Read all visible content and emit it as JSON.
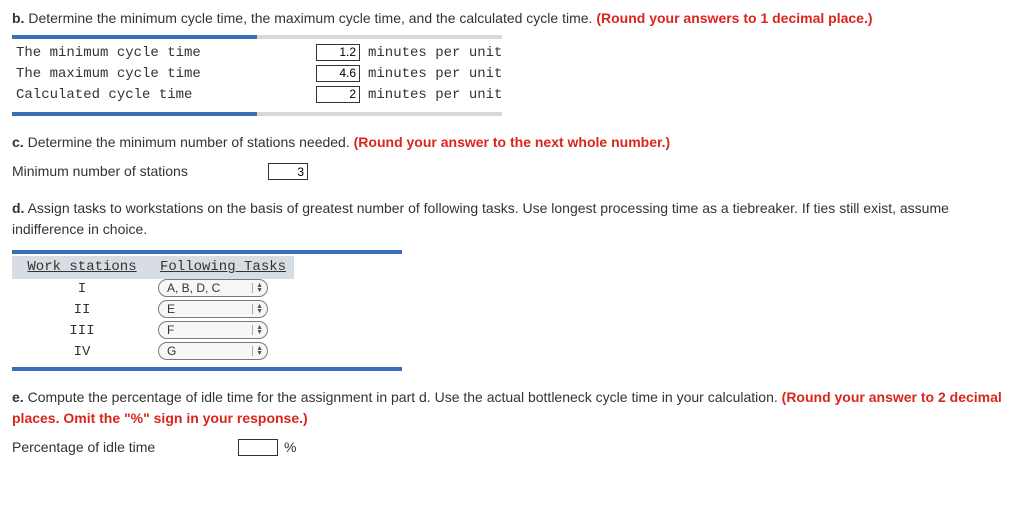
{
  "b": {
    "label": "b.",
    "text": "Determine the minimum cycle time, the maximum cycle time, and the calculated cycle time.",
    "note": "(Round your answers to 1 decimal place.)",
    "rows": [
      {
        "label": "The minimum cycle time",
        "value": "1.2",
        "unit": "minutes per unit"
      },
      {
        "label": "The maximum cycle time",
        "value": "4.6",
        "unit": "minutes per unit"
      },
      {
        "label": "Calculated cycle time",
        "value": "2",
        "unit": "minutes per unit"
      }
    ]
  },
  "c": {
    "label": "c.",
    "text": "Determine the minimum number of stations needed.",
    "note": "(Round your answer to the next whole number.)",
    "field_label": "Minimum number of stations",
    "value": "3"
  },
  "d": {
    "label": "d.",
    "text": "Assign tasks to workstations on the basis of greatest number of following tasks. Use longest processing time as a tiebreaker. If ties still exist, assume indifference in choice.",
    "header_ws": "Work stations",
    "header_ft": "Following Tasks",
    "rows": [
      {
        "ws": "I",
        "tasks": "A, B, D, C"
      },
      {
        "ws": "II",
        "tasks": "E"
      },
      {
        "ws": "III",
        "tasks": "F"
      },
      {
        "ws": "IV",
        "tasks": "G"
      }
    ]
  },
  "e": {
    "label": "e.",
    "text": "Compute the percentage of idle time for the assignment in part d. Use the actual bottleneck cycle time in your calculation.",
    "note": "(Round your answer to 2 decimal places. Omit the \"%\" sign in your response.)",
    "field_label": "Percentage of idle time",
    "value": "",
    "unit": "%"
  }
}
